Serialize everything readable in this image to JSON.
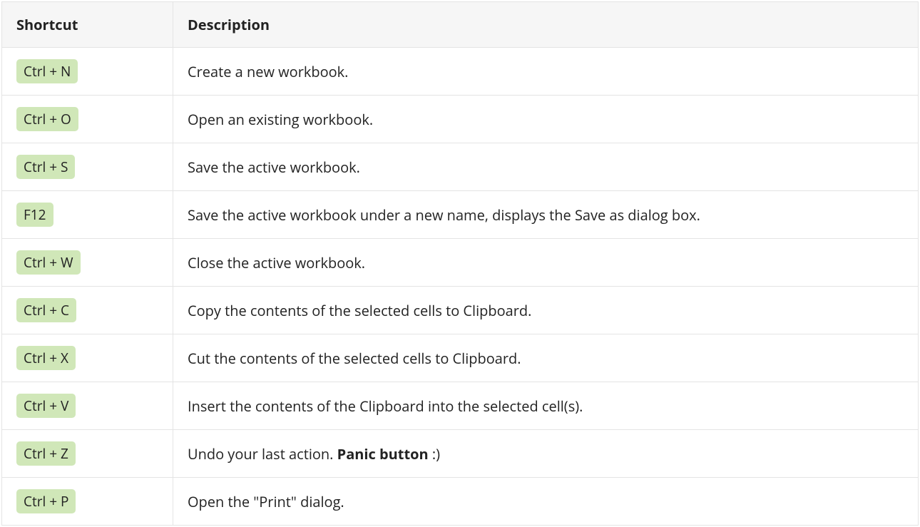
{
  "table": {
    "headers": {
      "shortcut": "Shortcut",
      "description": "Description"
    },
    "rows": [
      {
        "shortcut": "Ctrl + N",
        "desc_before": "Create a new workbook.",
        "desc_bold": "",
        "desc_after": ""
      },
      {
        "shortcut": "Ctrl + O",
        "desc_before": "Open an existing workbook.",
        "desc_bold": "",
        "desc_after": ""
      },
      {
        "shortcut": "Ctrl + S",
        "desc_before": "Save the active workbook.",
        "desc_bold": "",
        "desc_after": ""
      },
      {
        "shortcut": "F12",
        "desc_before": "Save the active workbook under a new name, displays the Save as dialog box.",
        "desc_bold": "",
        "desc_after": ""
      },
      {
        "shortcut": "Ctrl + W",
        "desc_before": "Close the active workbook.",
        "desc_bold": "",
        "desc_after": ""
      },
      {
        "shortcut": "Ctrl + C",
        "desc_before": "Copy the contents of the selected cells to Clipboard.",
        "desc_bold": "",
        "desc_after": ""
      },
      {
        "shortcut": "Ctrl + X",
        "desc_before": "Cut the contents of the selected cells to Clipboard.",
        "desc_bold": "",
        "desc_after": ""
      },
      {
        "shortcut": "Ctrl + V",
        "desc_before": "Insert the contents of the Clipboard into the selected cell(s).",
        "desc_bold": "",
        "desc_after": ""
      },
      {
        "shortcut": "Ctrl + Z",
        "desc_before": "Undo your last action. ",
        "desc_bold": "Panic button",
        "desc_after": " :)"
      },
      {
        "shortcut": "Ctrl + P",
        "desc_before": "Open the \"Print\" dialog.",
        "desc_bold": "",
        "desc_after": ""
      }
    ]
  }
}
